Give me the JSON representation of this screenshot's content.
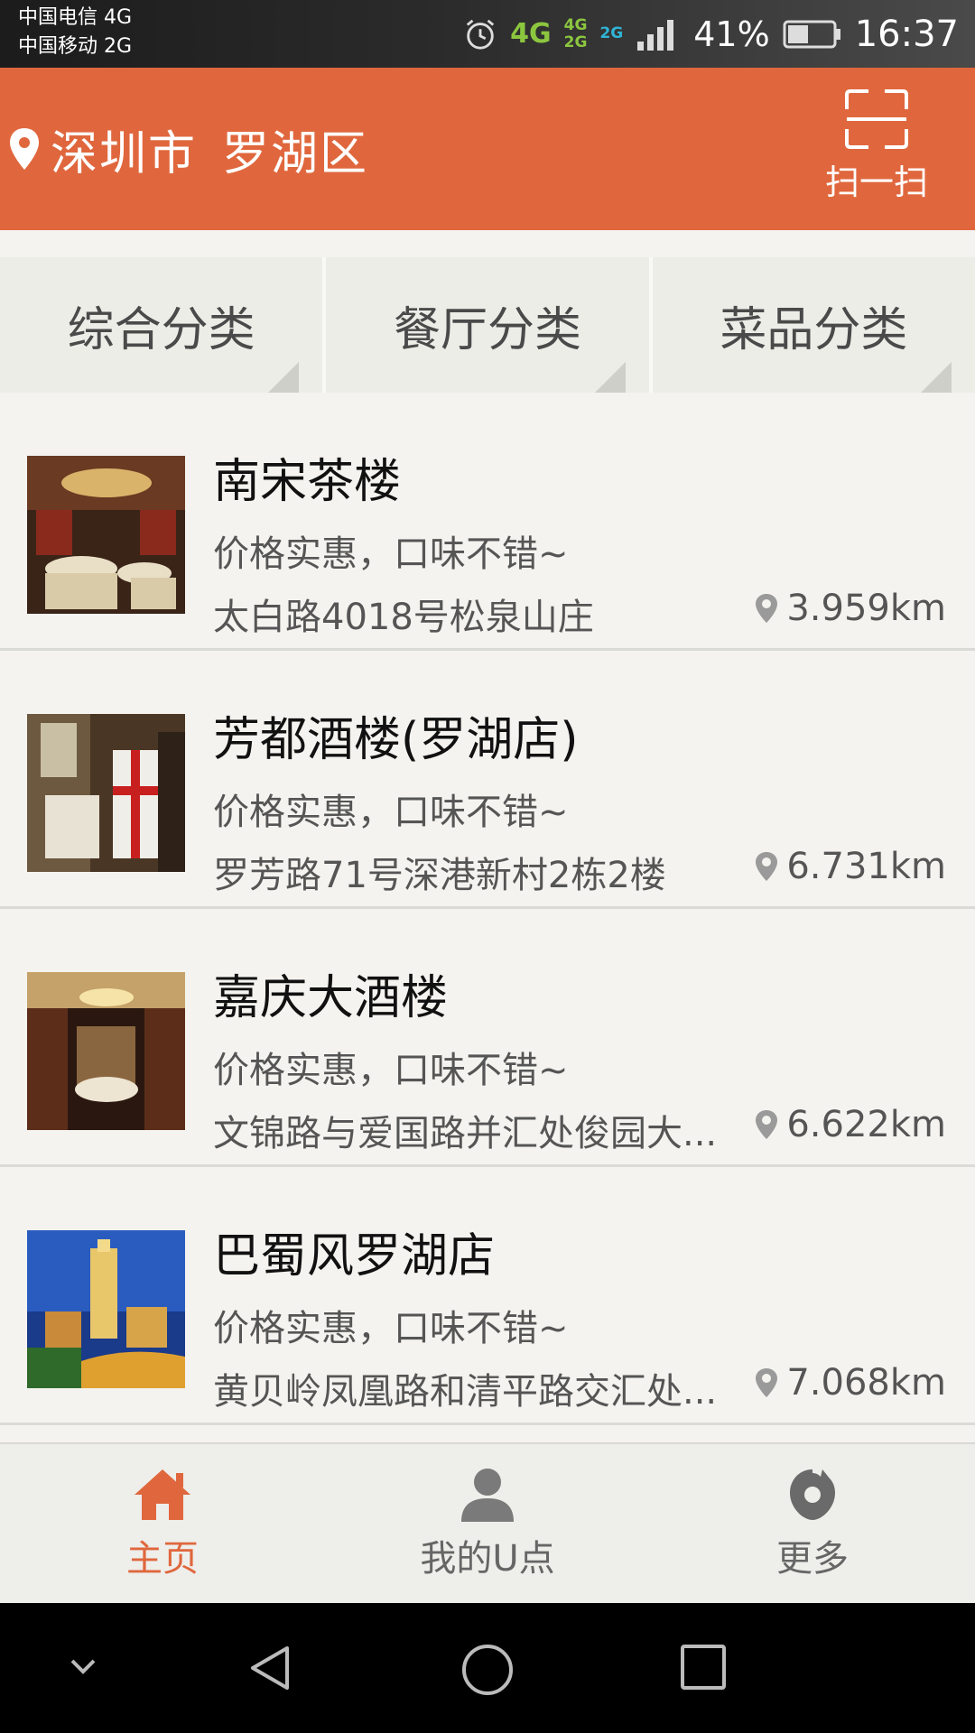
{
  "status_bar": {
    "carrier1": "中国电信 4G",
    "carrier2": "中国移动 2G",
    "net_main": "4G",
    "net_a": "4G",
    "net_b": "2G",
    "net_c": "2G",
    "battery": "41%",
    "time": "16:37"
  },
  "header": {
    "city": "深圳市",
    "district": "罗湖区",
    "scan_label": "扫一扫",
    "bg_color": "#e0673d"
  },
  "categories": [
    {
      "label": "综合分类"
    },
    {
      "label": "餐厅分类"
    },
    {
      "label": "菜品分类"
    }
  ],
  "restaurants": [
    {
      "name": "南宋茶楼",
      "desc": "价格实惠，口味不错~",
      "address": "太白路4018号松泉山庄",
      "distance": "3.959km"
    },
    {
      "name": "芳都酒楼(罗湖店)",
      "desc": "价格实惠，口味不错~",
      "address": "罗芳路71号深港新村2栋2楼",
      "distance": "6.731km"
    },
    {
      "name": "嘉庆大酒楼",
      "desc": "价格实惠，口味不错~",
      "address": "文锦路与爱国路并汇处俊园大...",
      "distance": "6.622km"
    },
    {
      "name": "巴蜀风罗湖店",
      "desc": "价格实惠，口味不错~",
      "address": "黄贝岭凤凰路和清平路交汇处...",
      "distance": "7.068km"
    }
  ],
  "bottom_nav": [
    {
      "label": "主页",
      "icon": "home-icon",
      "active": true
    },
    {
      "label": "我的U点",
      "icon": "user-icon",
      "active": false
    },
    {
      "label": "更多",
      "icon": "more-icon",
      "active": false
    }
  ]
}
